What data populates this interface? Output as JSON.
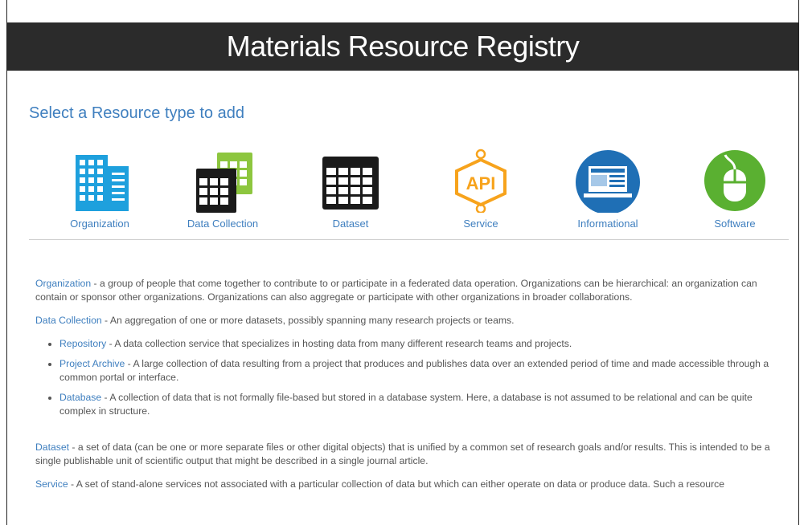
{
  "header": {
    "title": "Materials Resource Registry"
  },
  "section": {
    "subtitle": "Select a Resource type to add"
  },
  "tiles": [
    {
      "label": "Organization",
      "icon": "building-icon"
    },
    {
      "label": "Data Collection",
      "icon": "data-collection-icon"
    },
    {
      "label": "Dataset",
      "icon": "dataset-grid-icon"
    },
    {
      "label": "Service",
      "icon": "api-icon"
    },
    {
      "label": "Informational",
      "icon": "laptop-info-icon"
    },
    {
      "label": "Software",
      "icon": "mouse-icon"
    }
  ],
  "colors": {
    "accent": "#3f7fbf",
    "org_blue": "#1ea0dd",
    "collection_green": "#8dc63f",
    "api_orange": "#f7a31c",
    "info_blue": "#1f6fb5",
    "software_green": "#5ab031",
    "header_bg": "#2b2b2b"
  },
  "descriptions": {
    "organization": {
      "term": "Organization",
      "text": " - a group of people that come together to contribute to or participate in a federated data operation. Organizations can be hierarchical: an organization can contain or sponsor other organizations. Organizations can also aggregate or participate with other organizations in broader collaborations."
    },
    "data_collection": {
      "term": "Data Collection",
      "text": " - An aggregation of one or more datasets, possibly spanning many research projects or teams."
    },
    "subtypes": [
      {
        "term": "Repository",
        "text": " - A data collection service that specializes in hosting data from many different research teams and projects."
      },
      {
        "term": "Project Archive",
        "text": " - A large collection of data resulting from a project that produces and publishes data over an extended period of time and made accessible through a common portal or interface."
      },
      {
        "term": "Database",
        "text": " - A collection of data that is not formally file-based but stored in a database system. Here, a database is not assumed to be relational and can be quite complex in structure."
      }
    ],
    "dataset": {
      "term": "Dataset",
      "text": " - a set of data (can be one or more separate files or other digital objects) that is unified by a common set of research goals and/or results. This is intended to be a single publishable unit of scientific output that might be described in a single journal article."
    },
    "service": {
      "term": "Service",
      "text": " - A set of stand-alone services not associated with a particular collection of data but which can either operate on data or produce data. Such a resource"
    }
  }
}
